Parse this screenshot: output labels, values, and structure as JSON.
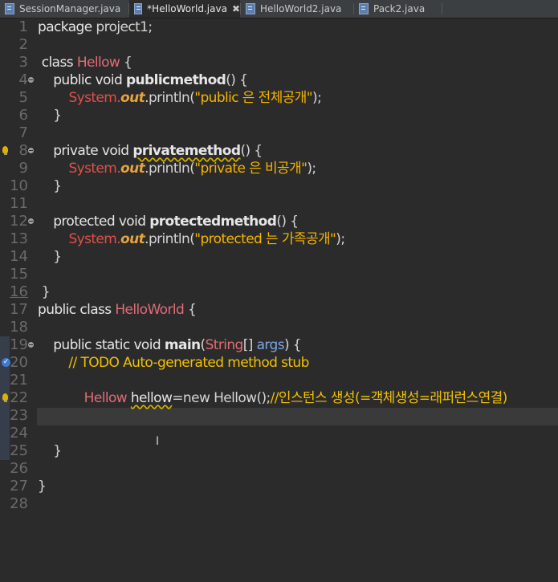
{
  "tabs": [
    {
      "label": "SessionManager.java"
    },
    {
      "label": "*HelloWorld.java"
    },
    {
      "label": "HelloWorld2.java"
    },
    {
      "label": "Pack2.java"
    }
  ],
  "lines": {
    "l1": "1",
    "l2": "2",
    "l3": "3",
    "l4": "4",
    "l5": "5",
    "l6": "6",
    "l7": "7",
    "l8": "8",
    "l9": "9",
    "l10": "10",
    "l11": "11",
    "l12": "12",
    "l13": "13",
    "l14": "14",
    "l15": "15",
    "l16": "16",
    "l17": "17",
    "l18": "18",
    "l19": "19",
    "l20": "20",
    "l21": "21",
    "l22": "22",
    "l23": "23",
    "l24": "24",
    "l25": "25",
    "l26": "26",
    "l27": "27",
    "l28": "28"
  },
  "code": {
    "c1a": "package",
    "c1b": " project1;",
    "c3a": " class ",
    "c3b": "Hellow",
    "c3c": " {",
    "c4a": "    public void ",
    "c4b": "publicmethod",
    "c4c": "() {",
    "c5a": "        ",
    "c5b": "System.",
    "c5c": "out",
    "c5d": ".println(",
    "c5e": "\"public 은 전체공개\"",
    "c5f": ");",
    "c6": "    }",
    "c8a": "    private void ",
    "c8b": "privatemethod",
    "c8c": "() {",
    "c9a": "        ",
    "c9b": "System.",
    "c9c": "out",
    "c9d": ".println(",
    "c9e": "\"private 은 비공개\"",
    "c9f": ");",
    "c10": "    }",
    "c12a": "    protected void ",
    "c12b": "protectedmethod",
    "c12c": "() {",
    "c13a": "        ",
    "c13b": "System.",
    "c13c": "out",
    "c13d": ".println(",
    "c13e": "\"protected 는 가족공개\"",
    "c13f": ");",
    "c14": "    }",
    "c16": " }",
    "c17a": "public class ",
    "c17b": "HelloWorld",
    "c17c": " {",
    "c19a": "    public static void ",
    "c19b": "main",
    "c19c": "(",
    "c19d": "String",
    "c19e": "[] ",
    "c19f": "args",
    "c19g": ") {",
    "c20": "        // TODO Auto-generated method stub",
    "c22a": "            ",
    "c22b": "Hellow",
    "c22c": " ",
    "c22d": "hellow",
    "c22e": "=new ",
    "c22f": "Hellow();",
    "c22g": "//인스턴스 생성(=객체생성=래퍼런스연결)",
    "c25": "    }",
    "c27": "}"
  }
}
